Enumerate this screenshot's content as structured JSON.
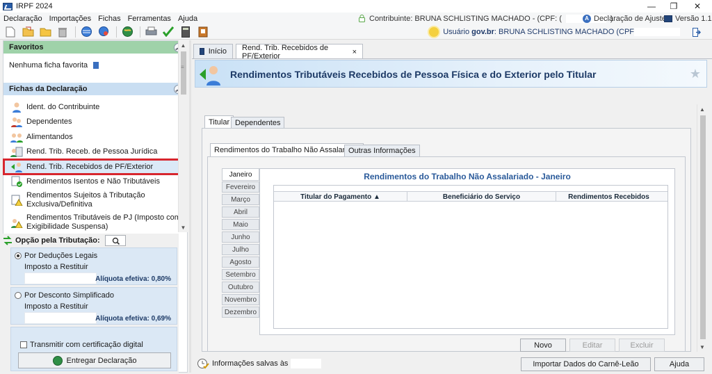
{
  "window": {
    "title": "IRPF 2024",
    "controls": [
      "—",
      "❐",
      "✕"
    ]
  },
  "menu": {
    "items": [
      "Declaração",
      "Importações",
      "Fichas",
      "Ferramentas",
      "Ajuda"
    ],
    "contribuinte": "Contribuinte: BRUNA SCHLISTING MACHADO - (CPF: (",
    "contribuinte_end": ")",
    "declaracao": "Declaração de Ajuste",
    "versao": "Versão 1.1"
  },
  "user": {
    "label": "Usuário",
    "brand": "gov.br",
    "name": ": BRUNA SCHLISTING MACHADO (CPF"
  },
  "left": {
    "favoritos_title": "Favoritos",
    "favoritos_empty": "Nenhuma ficha favorita",
    "fichas_title": "Fichas da Declaração",
    "fichas": [
      {
        "line1": "Ident. do Contribuinte",
        "line2": ""
      },
      {
        "line1": "Dependentes",
        "line2": ""
      },
      {
        "line1": "Alimentandos",
        "line2": ""
      },
      {
        "line1": "Rend. Trib. Receb. de Pessoa Jurídica",
        "line2": ""
      },
      {
        "line1": "Rend. Trib. Recebidos de PF/Exterior",
        "line2": ""
      },
      {
        "line1": "Rendimentos Isentos e Não Tributáveis",
        "line2": ""
      },
      {
        "line1": "Rendimentos Sujeitos à Tributação",
        "line2": "Exclusiva/Definitiva"
      },
      {
        "line1": "Rendimentos Tributáveis de PJ (Imposto com",
        "line2": "Exigibilidade Suspensa)"
      }
    ]
  },
  "tributacao": {
    "label": "Opção pela Tributação:",
    "deducoes": "Por Deduções Legais",
    "deducoes_sub": "Imposto a Restituir",
    "deducoes_aliquota": "Alíquota efetiva: 0,80%",
    "simplificado": "Por Desconto Simplificado",
    "simplificado_sub": "Imposto a Restituir",
    "simplificado_aliquota": "Alíquota efetiva: 0,69%",
    "certificado": "Transmitir com certificação digital",
    "entregar": "Entregar Declaração"
  },
  "tabs": {
    "inicio": "Início",
    "rend": "Rend. Trib. Recebidos de PF/Exterior",
    "close": "×"
  },
  "page": {
    "title": "Rendimentos Tributáveis Recebidos de Pessoa Física e do Exterior pelo Titular",
    "subtabs": [
      "Titular",
      "Dependentes"
    ],
    "innertabs": [
      "Rendimentos do Trabalho Não Assalariado",
      "Outras Informações"
    ],
    "months": [
      "Janeiro",
      "Fevereiro",
      "Março",
      "Abril",
      "Maio",
      "Junho",
      "Julho",
      "Agosto",
      "Setembro",
      "Outubro",
      "Novembro",
      "Dezembro"
    ],
    "panel_title": "Rendimentos do Trabalho Não Assalariado - Janeiro",
    "columns": [
      "Titular do Pagamento ▲",
      "Beneficiário do Serviço",
      "Rendimentos Recebidos"
    ],
    "novo": "Novo",
    "editar": "Editar",
    "excluir": "Excluir"
  },
  "status": {
    "info": "Informações salvas às",
    "importar": "Importar Dados do Carnê-Leão",
    "ajuda": "Ajuda"
  },
  "colors": {
    "accent_blue": "#1d3a66",
    "selected_outline": "#d7262e",
    "favoritos_bg": "#9fd2a9",
    "fichas_bg": "#c9def2"
  }
}
